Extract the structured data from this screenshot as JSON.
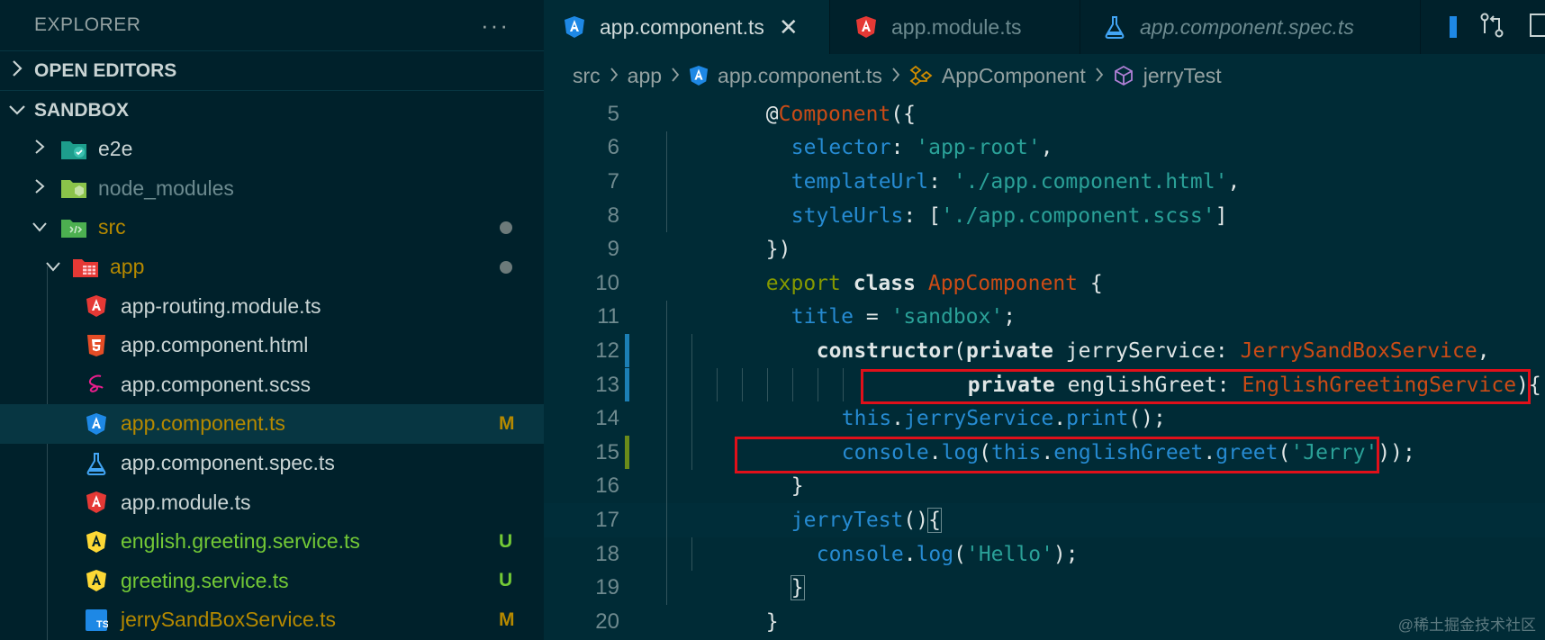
{
  "sidebar": {
    "title": "EXPLORER",
    "more": "···",
    "open_editors": "OPEN EDITORS",
    "workspace": "SANDBOX",
    "items": [
      {
        "label": "e2e",
        "color": "#93a1a1"
      },
      {
        "label": "node_modules",
        "color": "#6c8a8f"
      },
      {
        "label": "src",
        "color": "#b58900"
      },
      {
        "label": "app",
        "color": "#b58900"
      },
      {
        "label": "app-routing.module.ts",
        "color": "#c9d4d4"
      },
      {
        "label": "app.component.html",
        "color": "#c9d4d4"
      },
      {
        "label": "app.component.scss",
        "color": "#c9d4d4"
      },
      {
        "label": "app.component.ts",
        "color": "#b58900",
        "badge": "M"
      },
      {
        "label": "app.component.spec.ts",
        "color": "#c9d4d4"
      },
      {
        "label": "app.module.ts",
        "color": "#c9d4d4"
      },
      {
        "label": "english.greeting.service.ts",
        "color": "#73c936",
        "badge": "U"
      },
      {
        "label": "greeting.service.ts",
        "color": "#73c936",
        "badge": "U"
      },
      {
        "label": "jerrySandBoxService.ts",
        "color": "#b58900",
        "badge": "M"
      }
    ]
  },
  "tabs": [
    {
      "label": "app.component.ts",
      "close": "✕"
    },
    {
      "label": "app.module.ts"
    },
    {
      "label": "app.component.spec.ts"
    }
  ],
  "breadcrumb": {
    "src": "src",
    "app": "app",
    "file": "app.component.ts",
    "cls": "AppComponent",
    "method": "jerryTest"
  },
  "code": {
    "line_numbers": [
      "5",
      "6",
      "7",
      "8",
      "9",
      "10",
      "11",
      "12",
      "13",
      "14",
      "15",
      "16",
      "17",
      "18",
      "19",
      "20"
    ],
    "l5": [
      "@",
      "Component",
      "({"
    ],
    "l6": [
      "selector",
      ": ",
      "'app-root'",
      ","
    ],
    "l7": [
      "templateUrl",
      ": ",
      "'./app.component.html'",
      ","
    ],
    "l8": [
      "styleUrls",
      ": [",
      "'./app.component.scss'",
      "]"
    ],
    "l9": [
      "})"
    ],
    "l10": [
      "export",
      " ",
      "class",
      " ",
      "AppComponent",
      " {"
    ],
    "l11": [
      "title",
      " = ",
      "'sandbox'",
      ";"
    ],
    "l12": [
      "constructor",
      "(",
      "private",
      " jerryService",
      ": ",
      "JerrySandBoxService",
      ","
    ],
    "l13": [
      "private",
      " englishGreet",
      ": ",
      "EnglishGreetingService",
      "){"
    ],
    "l14": [
      "this",
      ".",
      "jerryService",
      ".",
      "print",
      "();"
    ],
    "l15": [
      "console",
      ".",
      "log",
      "(",
      "this",
      ".",
      "englishGreet",
      ".",
      "greet",
      "(",
      "'Jerry'",
      "));"
    ],
    "l16": [
      "}"
    ],
    "l17": [
      "jerryTest",
      "()",
      "{"
    ],
    "l18": [
      "console",
      ".",
      "log",
      "(",
      "'Hello'",
      ");"
    ],
    "l19": [
      "}"
    ],
    "l20": [
      "}"
    ]
  },
  "watermark": "@稀土掘金技术社区",
  "colors": {
    "background": "#002b36",
    "sidebar": "#00212b",
    "modified": "#b58900",
    "untracked": "#73c936",
    "highlight_box": "#e0101a"
  }
}
